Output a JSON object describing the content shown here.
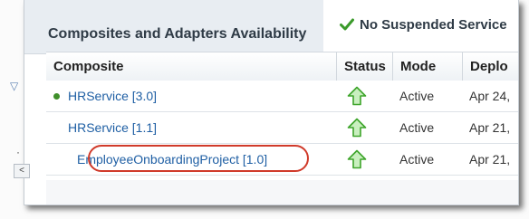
{
  "panel": {
    "title": "Composites and Adapters Availability",
    "notice_text": "No Suspended Service"
  },
  "table": {
    "columns": [
      "Composite",
      "Status",
      "Mode",
      "Deplo"
    ],
    "rows": [
      {
        "composite": "HRService [3.0]",
        "has_default_dot": true,
        "status_icon": "green-up-arrow",
        "mode": "Active",
        "deployed": "Apr 24,"
      },
      {
        "composite": "HRService [1.1]",
        "has_default_dot": false,
        "status_icon": "green-up-arrow",
        "mode": "Active",
        "deployed": "Apr 21,"
      },
      {
        "composite": "EmployeeOnboardingProject [1.0]",
        "has_default_dot": false,
        "status_icon": "green-up-arrow",
        "mode": "Active",
        "deployed": "Apr 21,"
      }
    ]
  },
  "scroll_left_glyph": "<",
  "colors": {
    "link": "#1f5fa4",
    "status_green": "#3ea52b",
    "highlight_red": "#d03a2a"
  }
}
